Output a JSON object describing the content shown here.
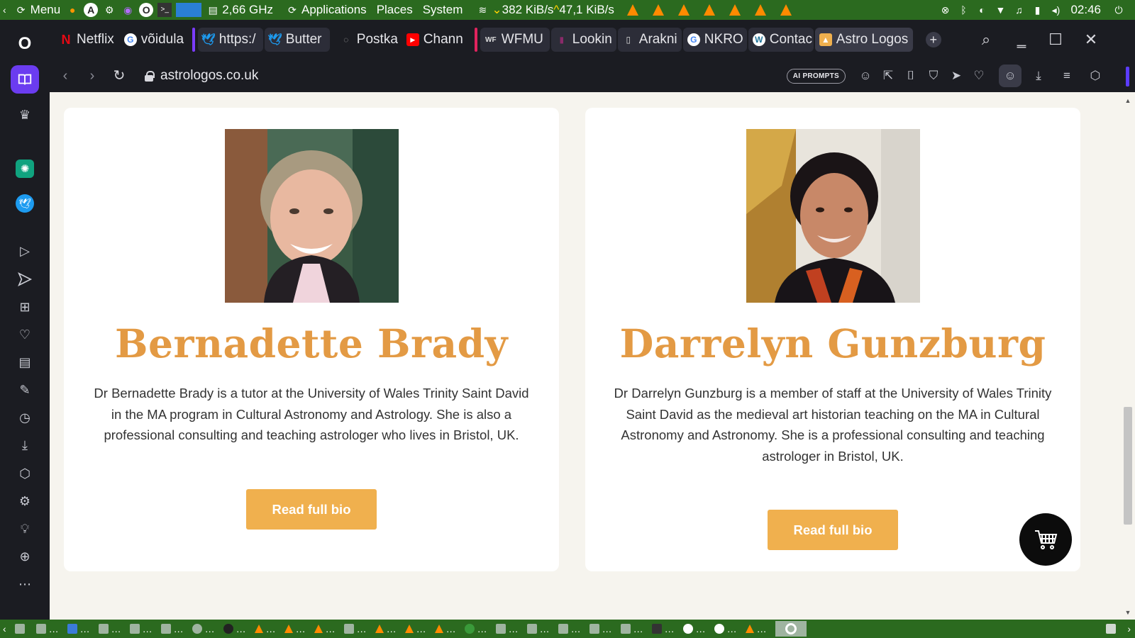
{
  "system_panel": {
    "menu_label": "Menu",
    "cpu_freq": "2,66 GHz",
    "applications_label": "Applications",
    "places_label": "Places",
    "system_label": "System",
    "net_down": "382 KiB/s",
    "net_up": "47,1 KiB/s",
    "clock": "02:46"
  },
  "tabs": [
    {
      "label": "Netflix",
      "icon": "netflix-icon"
    },
    {
      "label": "võidula",
      "icon": "google-icon"
    },
    {
      "label": "https:/",
      "icon": "twitter-icon"
    },
    {
      "label": "Butter",
      "icon": "twitter-icon"
    },
    {
      "label": "Postka",
      "icon": "loading-icon"
    },
    {
      "label": "Chann",
      "icon": "youtube-icon"
    },
    {
      "label": "WFMU",
      "icon": "wfmu-icon"
    },
    {
      "label": "Lookin",
      "icon": "page-icon"
    },
    {
      "label": "Arakni",
      "icon": "page-icon"
    },
    {
      "label": "NKRO",
      "icon": "google-icon"
    },
    {
      "label": "Contac",
      "icon": "wordpress-icon"
    },
    {
      "label": "Astro Logos",
      "icon": "astrologos-icon"
    }
  ],
  "address_bar": {
    "url": "astrologos.co.uk",
    "ai_prompts_label": "AI PROMPTS"
  },
  "cards": [
    {
      "name": "Bernadette Brady",
      "bio": "Dr Bernadette Brady is a tutor at the University of Wales Trinity Saint David in the MA program in Cultural Astronomy and Astrology. She is also a professional consulting and teaching astrologer who lives in Bristol, UK.",
      "button_label": "Read full bio"
    },
    {
      "name": "Darrelyn Gunzburg",
      "bio": "Dr Darrelyn Gunzburg is a member of staff at the University of Wales Trinity Saint David as the medieval art historian teaching on the MA in Cultural Astronomy and Astronomy. She is a professional consulting and teaching astrologer in Bristol, UK.",
      "button_label": "Read full bio"
    }
  ],
  "colors": {
    "name_accent": "#e39a44",
    "button_bg": "#f0b04e",
    "page_bg": "#f6f4ee",
    "panel_green": "#2b6a1f"
  }
}
